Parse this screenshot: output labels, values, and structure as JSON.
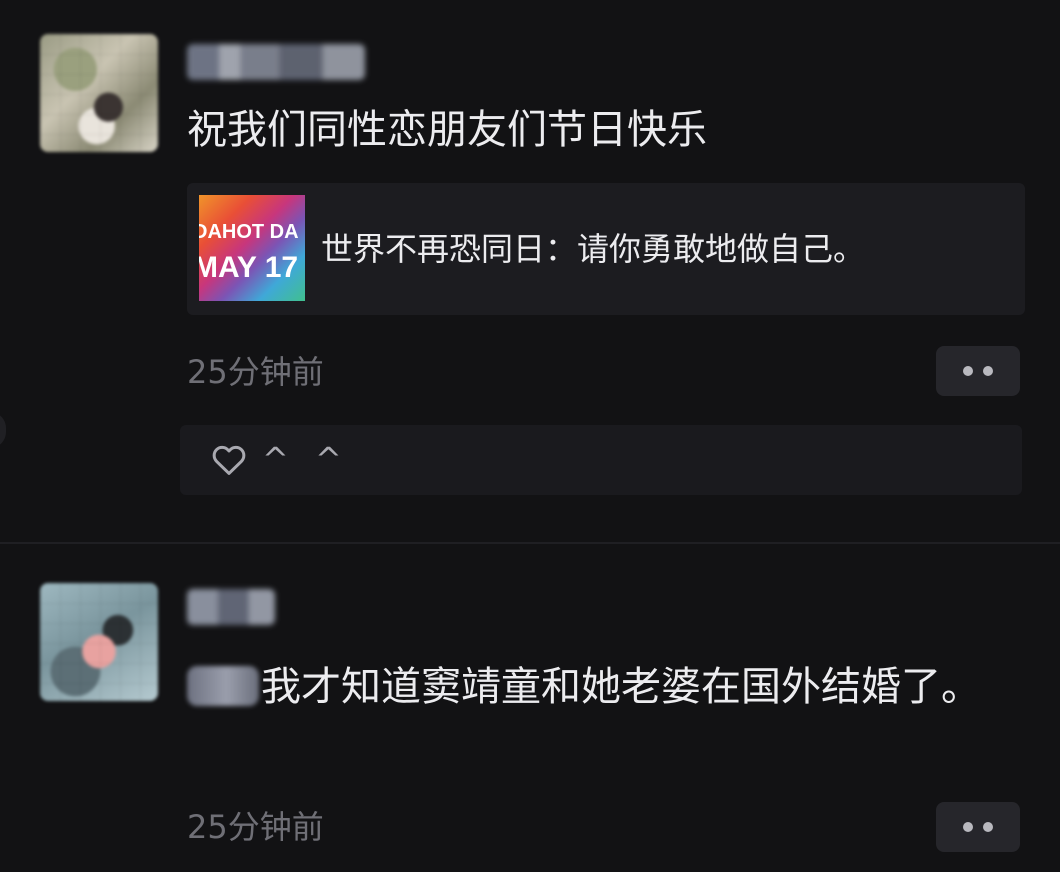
{
  "posts": [
    {
      "text": "祝我们同性恋朋友们节日快乐",
      "link_card": {
        "thumbnail_line_1": "DAHOT DA",
        "thumbnail_line_2": "MAY 17",
        "title": "世界不再恐同日：请你勇敢地做自己。"
      },
      "timestamp": "25分钟前",
      "reactions": {
        "icon": "heart-icon",
        "text": "^ ^"
      }
    },
    {
      "text": "我才知道窦靖童和她老婆在国外结婚了。",
      "timestamp": "25分钟前"
    }
  ],
  "colors": {
    "background": "#121214",
    "card_background": "#1c1c20",
    "text_primary": "#ececef",
    "text_secondary": "#6f6f76",
    "button_background": "#26262b"
  }
}
